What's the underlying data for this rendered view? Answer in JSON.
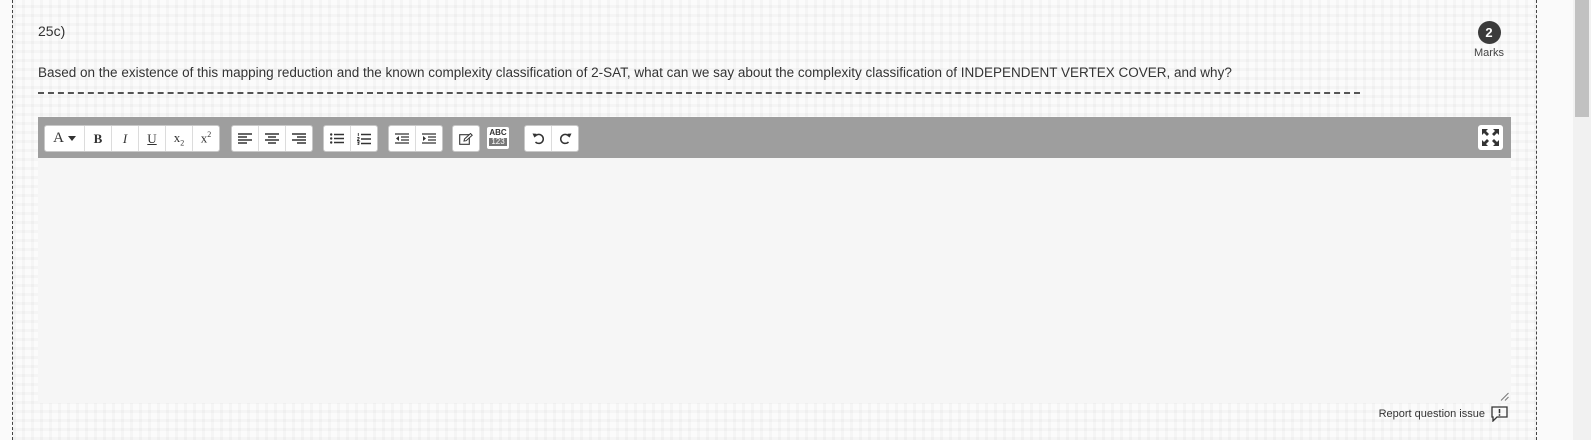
{
  "question": {
    "number": "25c)",
    "marks_value": "2",
    "marks_label": "Marks",
    "text": "Based on the existence of this mapping reduction and the known complexity classification of 2-SAT, what can we say about the complexity classification of INDEPENDENT VERTEX COVER, and why?"
  },
  "toolbar": {
    "font_label": "A",
    "bold_label": "B",
    "italic_label": "I",
    "underline_label": "U",
    "subscript_base": "x",
    "subscript_mark": "2",
    "superscript_base": "x",
    "superscript_mark": "2",
    "spellcheck_top": "ABC",
    "spellcheck_bottom": "123",
    "icons": [
      "font-icon",
      "bold-icon",
      "italic-icon",
      "underline-icon",
      "subscript-icon",
      "superscript-icon",
      "align-left-icon",
      "align-center-icon",
      "align-right-icon",
      "bullet-list-icon",
      "numbered-list-icon",
      "outdent-icon",
      "indent-icon",
      "edit-icon",
      "spellcheck-icon",
      "undo-icon",
      "redo-icon",
      "expand-icon"
    ]
  },
  "editor": {
    "value": ""
  },
  "footer": {
    "report_label": "Report question issue"
  },
  "colors": {
    "toolbar_bg": "#9e9e9e",
    "marks_circle": "#3b3b3b",
    "editor_bg": "#f6f6f6"
  }
}
